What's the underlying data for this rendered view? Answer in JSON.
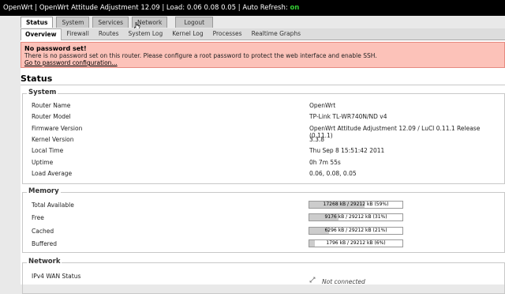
{
  "header": {
    "title_text": "OpenWrt | OpenWrt Attitude Adjustment 12.09 | Load: 0.06 0.08 0.05 | Auto Refresh: ",
    "auto_refresh_state": "on"
  },
  "top_tabs": [
    {
      "label": "Status",
      "active": true
    },
    {
      "label": "System"
    },
    {
      "label": "Services"
    },
    {
      "label": "Network"
    },
    {
      "label": "Logout"
    }
  ],
  "sub_tabs": [
    {
      "label": "Overview",
      "active": true
    },
    {
      "label": "Firewall"
    },
    {
      "label": "Routes"
    },
    {
      "label": "System Log"
    },
    {
      "label": "Kernel Log"
    },
    {
      "label": "Processes"
    },
    {
      "label": "Realtime Graphs"
    }
  ],
  "alert": {
    "title": "No password set!",
    "body": "There is no password set on this router. Please configure a root password to protect the web interface and enable SSH.",
    "link": "Go to password configuration..."
  },
  "page_title": "Status",
  "system": {
    "legend": "System",
    "rows": [
      {
        "label": "Router Name",
        "value": "OpenWrt"
      },
      {
        "label": "Router Model",
        "value": "TP-Link TL-WR740N/ND v4"
      },
      {
        "label": "Firmware Version",
        "value": "OpenWrt Attitude Adjustment 12.09 / LuCI 0.11.1 Release (0.11.1)"
      },
      {
        "label": "Kernel Version",
        "value": "3.3.8"
      },
      {
        "label": "Local Time",
        "value": "Thu Sep 8 15:51:42 2011"
      },
      {
        "label": "Uptime",
        "value": "0h 7m 55s"
      },
      {
        "label": "Load Average",
        "value": "0.06, 0.08, 0.05"
      }
    ]
  },
  "memory": {
    "legend": "Memory",
    "rows": [
      {
        "label": "Total Available",
        "text": "17268 kB / 29212 kB (59%)",
        "percent": 59
      },
      {
        "label": "Free",
        "text": "9176 kB / 29212 kB (31%)",
        "percent": 31
      },
      {
        "label": "Cached",
        "text": "6296 kB / 29212 kB (21%)",
        "percent": 21
      },
      {
        "label": "Buffered",
        "text": "1796 kB / 29212 kB (6%)",
        "percent": 6
      }
    ]
  },
  "network": {
    "legend": "Network",
    "wan_label": "IPv4 WAN Status",
    "wan_status": "Not connected",
    "wan_icon": "network-disconnected-icon"
  }
}
